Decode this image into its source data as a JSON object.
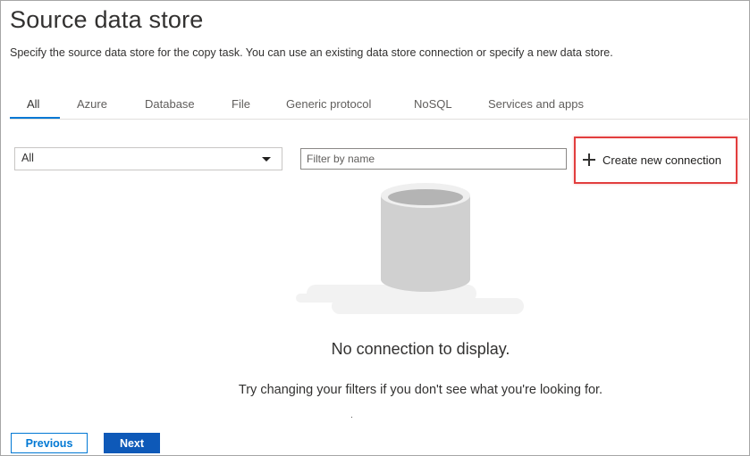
{
  "header": {
    "title": "Source data store",
    "subtitle": "Specify the source data store for the copy task. You can use an existing data store connection or specify a new data store."
  },
  "tabs": [
    {
      "label": "All",
      "active": true
    },
    {
      "label": "Azure",
      "active": false
    },
    {
      "label": "Database",
      "active": false
    },
    {
      "label": "File",
      "active": false
    },
    {
      "label": "Generic protocol",
      "active": false
    },
    {
      "label": "NoSQL",
      "active": false
    },
    {
      "label": "Services and apps",
      "active": false
    }
  ],
  "filters": {
    "type_select_value": "All",
    "name_filter_placeholder": "Filter by name",
    "name_filter_value": ""
  },
  "actions": {
    "create_label": "Create new connection",
    "create_icon": "plus-icon"
  },
  "empty_state": {
    "title": "No connection to display.",
    "hint": "Try changing your filters if you don't see what you're looking for.",
    "icon": "empty-database-icon"
  },
  "footer": {
    "previous_label": "Previous",
    "next_label": "Next"
  },
  "colors": {
    "accent": "#0078d4",
    "next_button": "#0e59b8",
    "highlight": "#e23e3e"
  }
}
